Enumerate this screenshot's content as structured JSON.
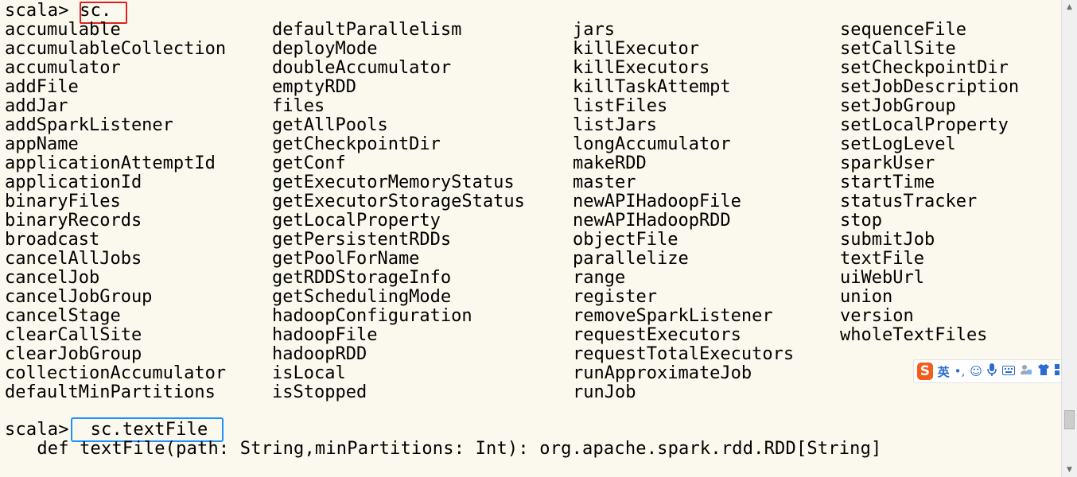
{
  "terminal": {
    "prompt1": "scala> ",
    "input1": "sc.",
    "columns": [
      [
        "accumulable",
        "accumulableCollection",
        "accumulator",
        "addFile",
        "addJar",
        "addSparkListener",
        "appName",
        "applicationAttemptId",
        "applicationId",
        "binaryFiles",
        "binaryRecords",
        "broadcast",
        "cancelAllJobs",
        "cancelJob",
        "cancelJobGroup",
        "cancelStage",
        "clearCallSite",
        "clearJobGroup",
        "collectionAccumulator",
        "defaultMinPartitions"
      ],
      [
        "defaultParallelism",
        "deployMode",
        "doubleAccumulator",
        "emptyRDD",
        "files",
        "getAllPools",
        "getCheckpointDir",
        "getConf",
        "getExecutorMemoryStatus",
        "getExecutorStorageStatus",
        "getLocalProperty",
        "getPersistentRDDs",
        "getPoolForName",
        "getRDDStorageInfo",
        "getSchedulingMode",
        "hadoopConfiguration",
        "hadoopFile",
        "hadoopRDD",
        "isLocal",
        "isStopped"
      ],
      [
        "jars",
        "killExecutor",
        "killExecutors",
        "killTaskAttempt",
        "listFiles",
        "listJars",
        "longAccumulator",
        "makeRDD",
        "master",
        "newAPIHadoopFile",
        "newAPIHadoopRDD",
        "objectFile",
        "parallelize",
        "range",
        "register",
        "removeSparkListener",
        "requestExecutors",
        "requestTotalExecutors",
        "runApproximateJob",
        "runJob"
      ],
      [
        "sequenceFile",
        "setCallSite",
        "setCheckpointDir",
        "setJobDescription",
        "setJobGroup",
        "setLocalProperty",
        "setLogLevel",
        "sparkUser",
        "startTime",
        "statusTracker",
        "stop",
        "submitJob",
        "textFile",
        "uiWebUrl",
        "union",
        "version",
        "wholeTextFiles"
      ]
    ],
    "prompt2": "scala> ",
    "input2": "sc.textFile",
    "signature": "   def textFile(path: String,minPartitions: Int): org.apache.spark.rdd.RDD[String]"
  },
  "ime_toolbar": {
    "logo": "S",
    "lang": "英",
    "icons": [
      "punctuation-icon",
      "emoji-icon",
      "microphone-icon",
      "keyboard-icon",
      "user-icon",
      "shirt-icon",
      "grid-icon"
    ]
  },
  "colors": {
    "background": "#fbf8ee",
    "highlight_red": "#e02020",
    "highlight_blue": "#1e90ff",
    "ime_brand": "#f35c1c"
  }
}
